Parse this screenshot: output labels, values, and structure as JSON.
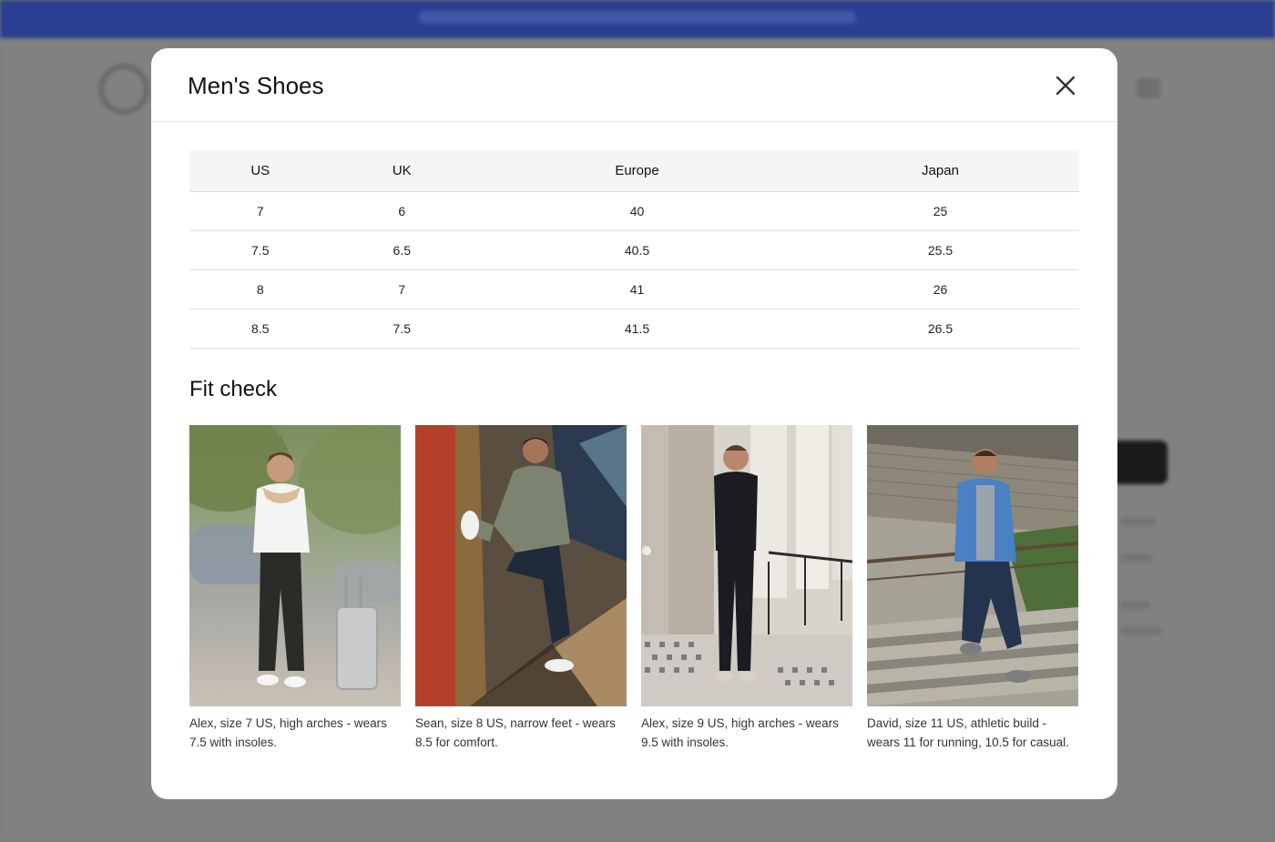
{
  "modal": {
    "title": "Men's Shoes",
    "close_icon": "close-icon"
  },
  "size_table": {
    "headers": [
      "US",
      "UK",
      "Europe",
      "Japan"
    ],
    "rows": [
      [
        "7",
        "6",
        "40",
        "25"
      ],
      [
        "7.5",
        "6.5",
        "40.5",
        "25.5"
      ],
      [
        "8",
        "7",
        "41",
        "26"
      ],
      [
        "8.5",
        "7.5",
        "41.5",
        "26.5"
      ]
    ]
  },
  "fit_check": {
    "title": "Fit check",
    "items": [
      {
        "caption": "Alex, size 7 US, high arches - wears 7.5 with insoles."
      },
      {
        "caption": "Sean, size 8 US, narrow feet - wears 8.5 for comfort."
      },
      {
        "caption": "Alex, size 9 US, high arches - wears 9.5 with insoles."
      },
      {
        "caption": "David, size 11 US, athletic build - wears 11 for running, 10.5 for casual."
      }
    ]
  },
  "colors": {
    "backdrop": "#7b7b7b",
    "banner": "#2a3f8f",
    "header_row": "#f5f5f5",
    "border": "#dedede"
  }
}
